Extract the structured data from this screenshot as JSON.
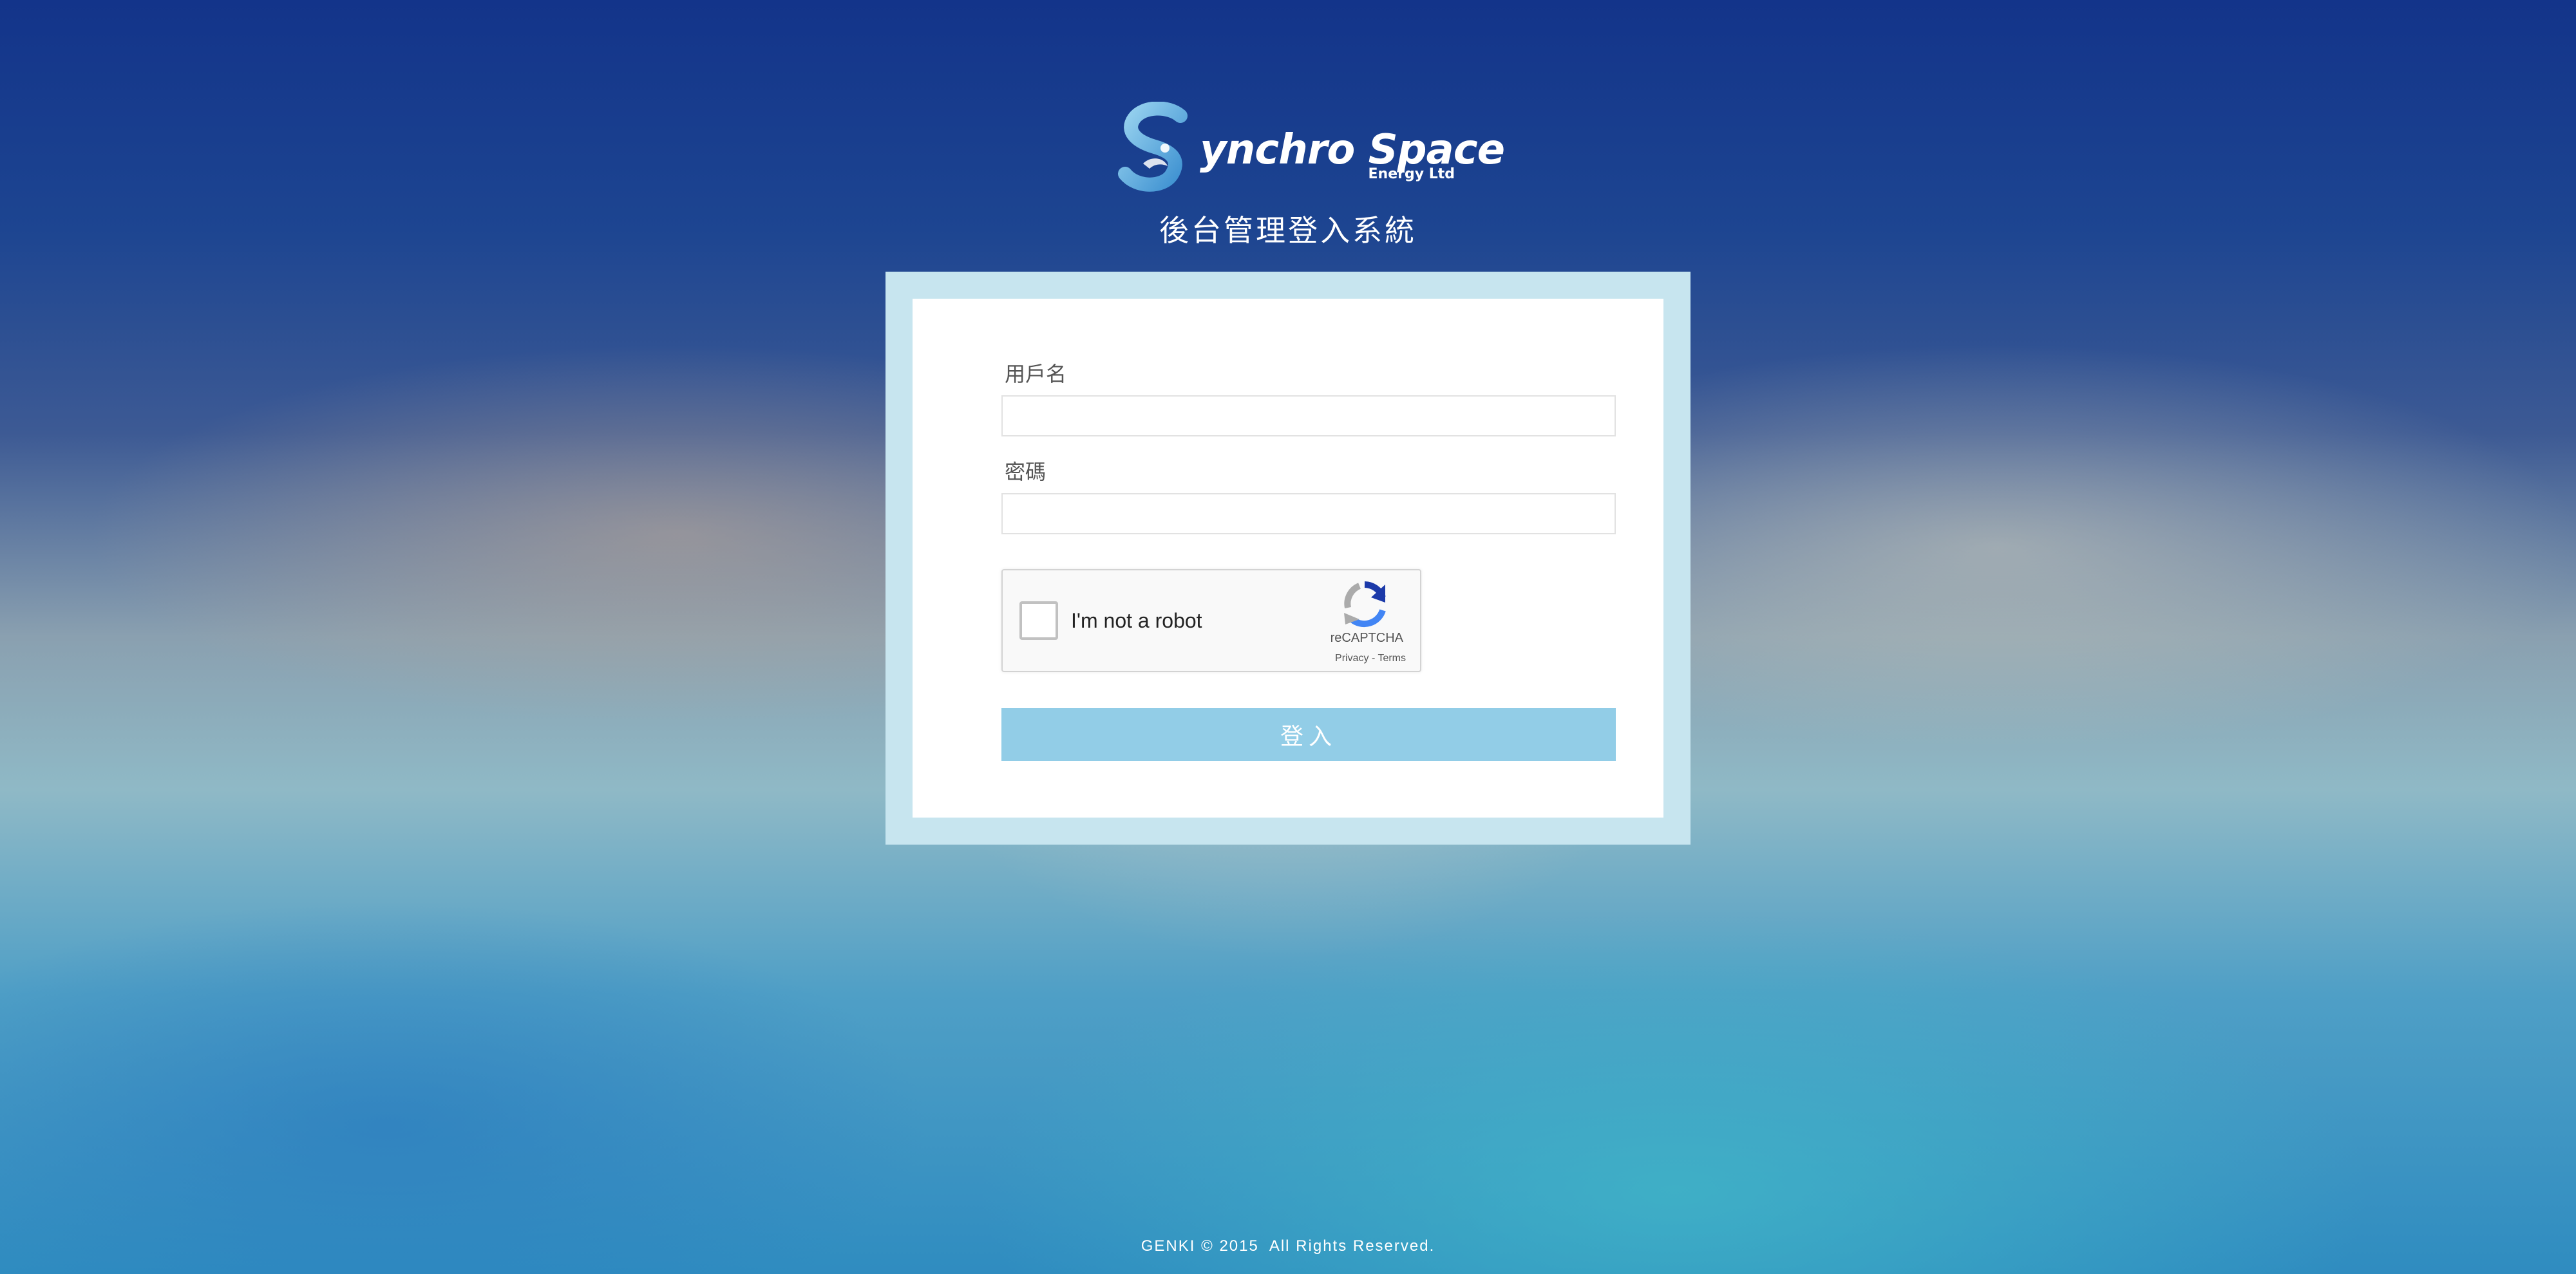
{
  "logo": {
    "name": "ynchro Space",
    "sub": "Energy Ltd",
    "icon": "synchro-space-s-logo"
  },
  "header": {
    "title": "後台管理登入系統"
  },
  "login_form": {
    "username_label": "用戶名",
    "username_value": "",
    "password_label": "密碼",
    "password_value": "",
    "submit_label": "登入",
    "submit_color": "#92cde7",
    "frame_color": "#c7e5ef"
  },
  "recaptcha": {
    "checkbox_label": "I'm not a robot",
    "brand": "reCAPTCHA",
    "privacy_link": "Privacy",
    "separator": " - ",
    "terms_link": "Terms",
    "checked": false,
    "icon": "recaptcha-icon"
  },
  "footer": {
    "copyright": "GENKI © 2015  All Rights Reserved."
  }
}
